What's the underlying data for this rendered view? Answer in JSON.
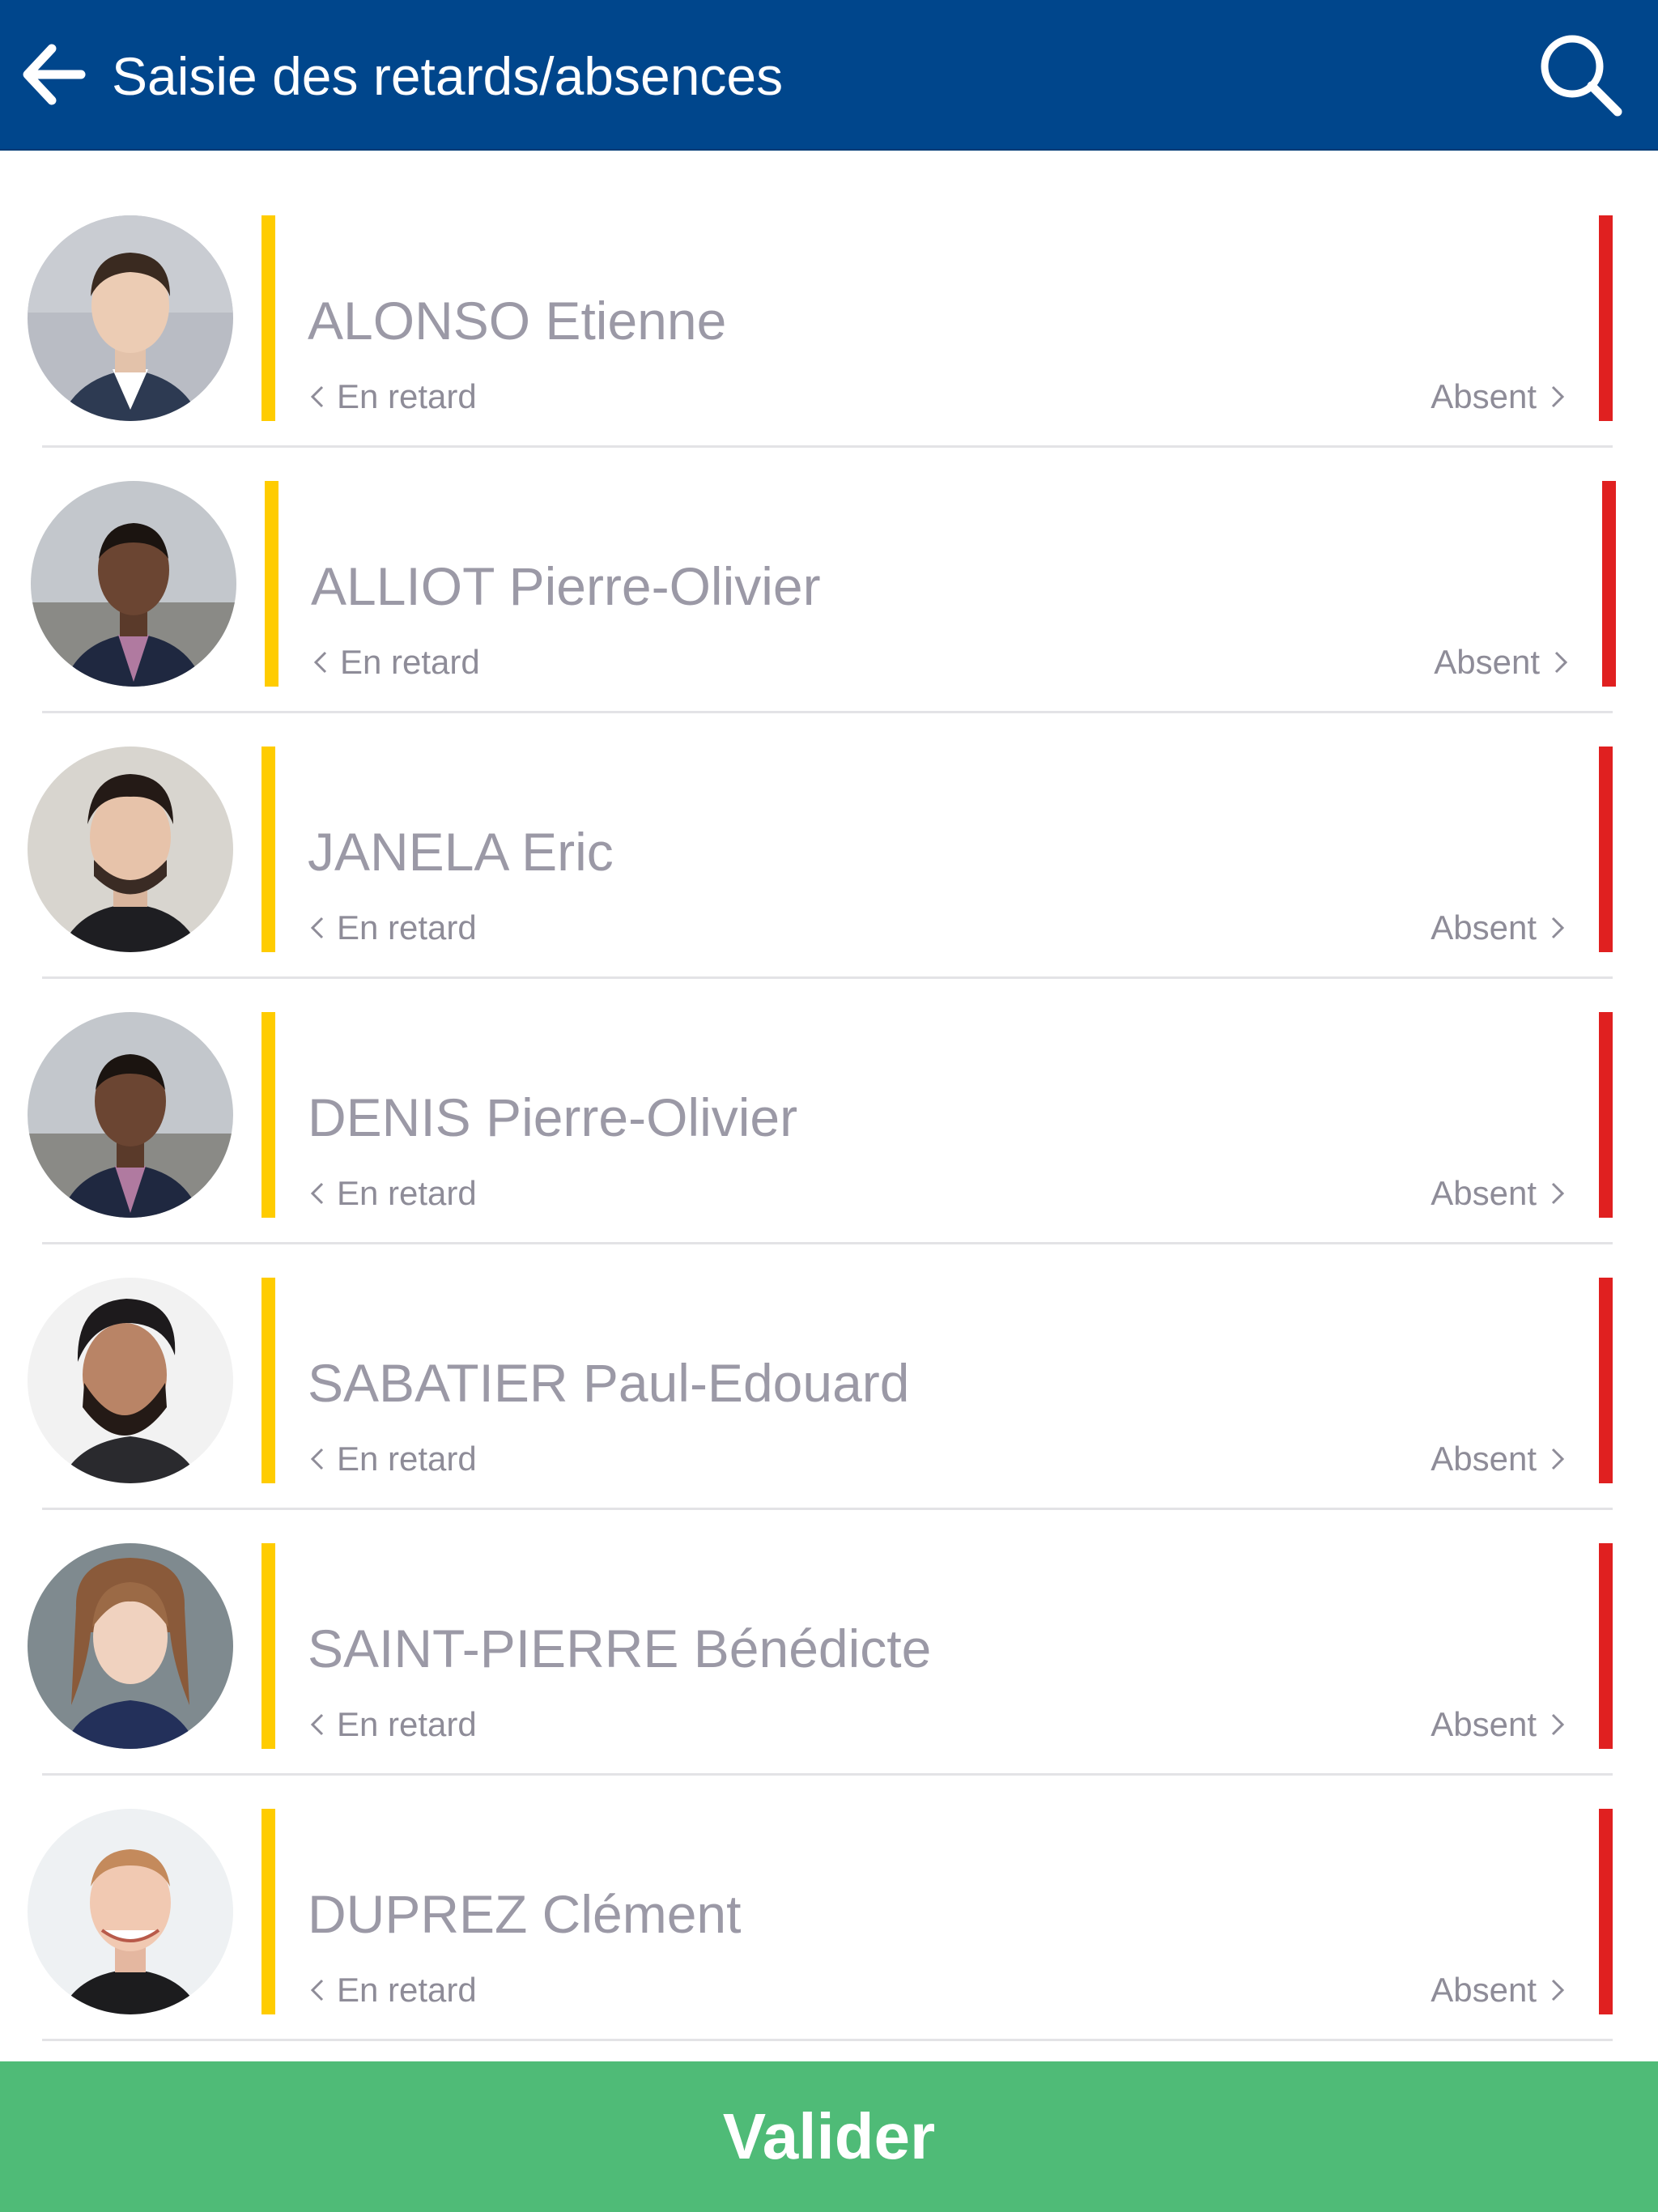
{
  "header": {
    "title": "Saisie des retards/absences",
    "back_icon": "arrow-left-icon",
    "search_icon": "search-icon",
    "background_color": "#00468c"
  },
  "students": [
    {
      "name": "ALONSO Etienne",
      "late_label": "En retard",
      "absent_label": "Absent"
    },
    {
      "name": "ALLIOT Pierre-Olivier",
      "late_label": "En retard",
      "absent_label": "Absent"
    },
    {
      "name": "JANELA Eric",
      "late_label": "En retard",
      "absent_label": "Absent"
    },
    {
      "name": "DENIS Pierre-Olivier",
      "late_label": "En retard",
      "absent_label": "Absent"
    },
    {
      "name": "SABATIER Paul-Edouard",
      "late_label": "En retard",
      "absent_label": "Absent"
    },
    {
      "name": "SAINT-PIERRE Bénédicte",
      "late_label": "En retard",
      "absent_label": "Absent"
    },
    {
      "name": "DUPREZ Clément",
      "late_label": "En retard",
      "absent_label": "Absent"
    }
  ],
  "colors": {
    "late_indicator": "#ffcc00",
    "absent_indicator": "#e02020",
    "validate_button": "#4fbb77"
  },
  "footer": {
    "validate_label": "Valider"
  }
}
